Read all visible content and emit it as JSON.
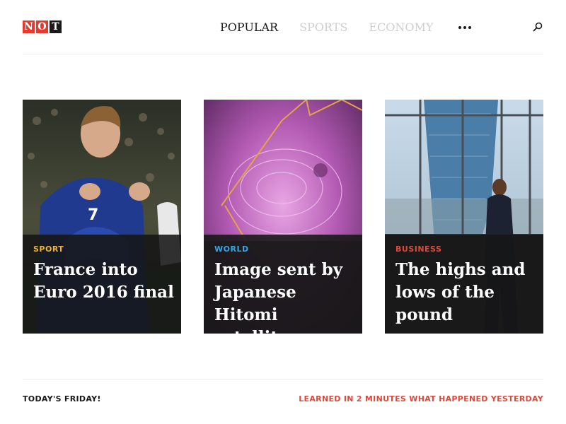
{
  "logo": {
    "letters": [
      "N",
      "O",
      "T"
    ]
  },
  "nav": {
    "items": [
      {
        "label": "POPULAR"
      },
      {
        "label": "SPORTS"
      },
      {
        "label": "ECONOMY"
      }
    ],
    "more_icon": "ellipsis-icon",
    "search_icon": "search-icon"
  },
  "cards": [
    {
      "category": "SPORT",
      "category_color": "#f0b429",
      "title": "France into Euro 2016 final"
    },
    {
      "category": "WORLD",
      "category_color": "#35a7e6",
      "title": "Image sent by Japanese Hitomi satellite"
    },
    {
      "category": "BUSINESS",
      "category_color": "#e0483a",
      "title": "The highs and lows of the pound"
    }
  ],
  "footer": {
    "left": "TODAY'S FRIDAY!",
    "right": "LEARNED IN 2 MINUTES WHAT HAPPENED YESTERDAY"
  },
  "colors": {
    "accent": "#e63a2e",
    "text": "#1a1a1a",
    "inactive_nav": "#cfcfcf"
  }
}
